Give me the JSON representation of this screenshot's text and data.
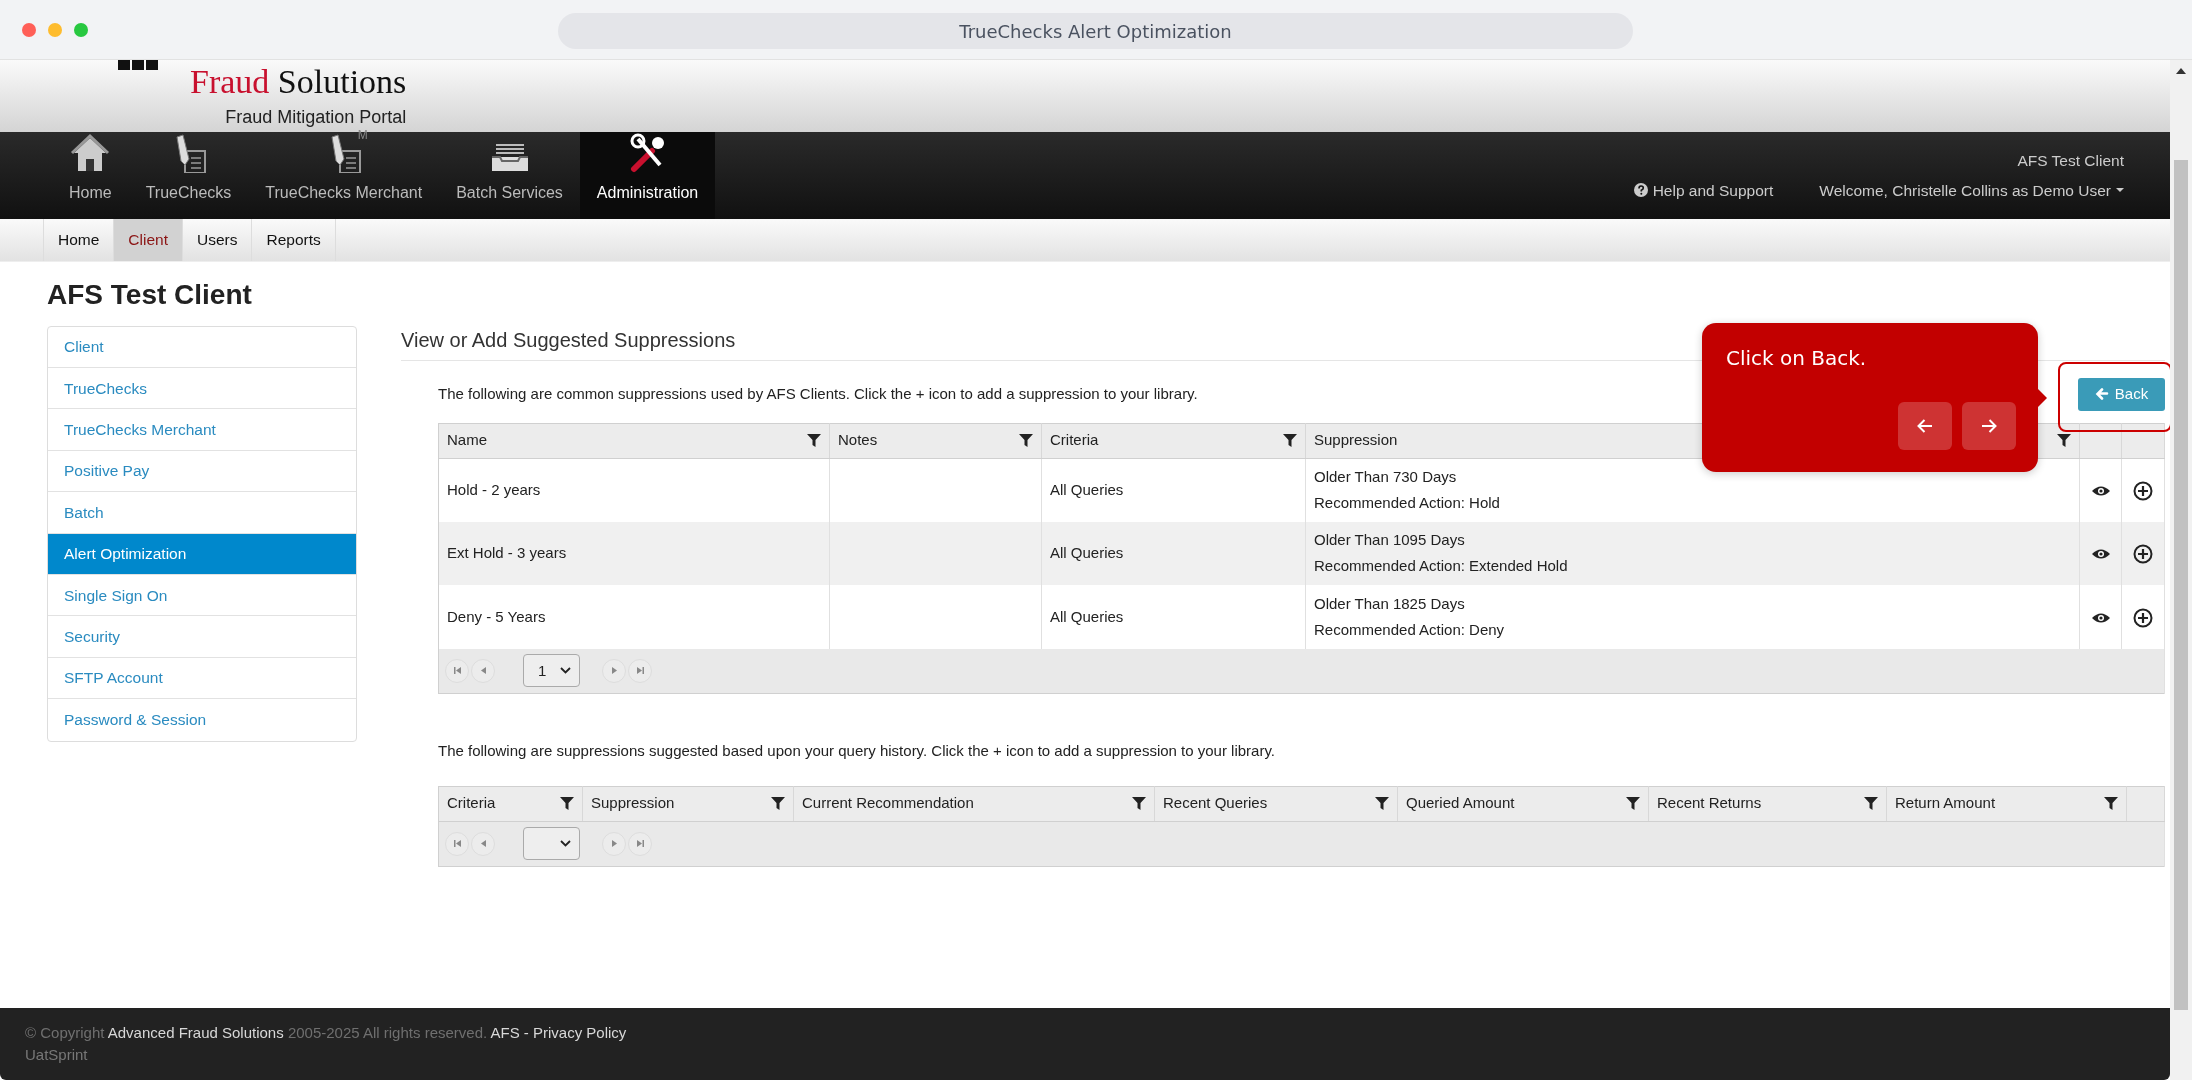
{
  "window": {
    "title": "TrueChecks Alert Optimization"
  },
  "header": {
    "logo_words": [
      {
        "text": "Fraud",
        "accent": true
      },
      {
        "text": "Solutions",
        "accent": false
      }
    ],
    "logo_subtitle": "Fraud Mitigation Portal"
  },
  "nav": {
    "items": [
      {
        "kind": "home",
        "label": "Home",
        "selected": false
      },
      {
        "kind": "pen",
        "label": "TrueChecks",
        "selected": false
      },
      {
        "kind": "pen",
        "label": "TrueChecks Merchant",
        "icon_letter": "M",
        "selected": false
      },
      {
        "kind": "tray",
        "label": "Batch Services",
        "selected": false
      },
      {
        "kind": "tools",
        "label": "Administration",
        "selected": true
      }
    ],
    "client": "AFS Test Client",
    "help": "Help and Support",
    "user": "Welcome, Christelle Collins as Demo User"
  },
  "subnav": [
    {
      "label": "Home",
      "selected": false
    },
    {
      "label": "Client",
      "selected": true
    },
    {
      "label": "Users",
      "selected": false
    },
    {
      "label": "Reports",
      "selected": false
    }
  ],
  "page_title": "AFS Test Client",
  "sidebar": {
    "items": [
      {
        "label": "Client",
        "selected": false
      },
      {
        "label": "TrueChecks",
        "selected": false
      },
      {
        "label": "TrueChecks Merchant",
        "selected": false
      },
      {
        "label": "Positive Pay",
        "selected": false
      },
      {
        "label": "Batch",
        "selected": false
      },
      {
        "label": "Alert Optimization",
        "selected": true
      },
      {
        "label": "Single Sign On",
        "selected": false
      },
      {
        "label": "Security",
        "selected": false
      },
      {
        "label": "SFTP Account",
        "selected": false
      },
      {
        "label": "Password & Session",
        "selected": false
      }
    ]
  },
  "section": {
    "title": "View or Add Suggested Suppressions",
    "intro": "The following are common suppressions used by AFS Clients. Click the + icon to add a suppression to your library.",
    "back_button": "Back",
    "table": {
      "columns": [
        {
          "label": "Name",
          "filter": true
        },
        {
          "label": "Notes",
          "filter": true
        },
        {
          "label": "Criteria",
          "filter": true
        },
        {
          "label": "Suppression",
          "filter": true
        }
      ],
      "rows": [
        {
          "name": "Hold - 2 years",
          "criteria": "All Queries",
          "suppression": [
            "Older Than 730 Days",
            "Recommended Action: Hold"
          ]
        },
        {
          "name": "Ext Hold - 3 years",
          "criteria": "All Queries",
          "suppression": [
            "Older Than 1095 Days",
            "Recommended Action: Extended Hold"
          ]
        },
        {
          "name": "Deny - 5 Years",
          "criteria": "All Queries",
          "suppression": [
            "Older Than 1825 Days",
            "Recommended Action: Deny"
          ]
        }
      ],
      "pager": {
        "page": "1"
      }
    },
    "history_intro": "The following are suppressions suggested based upon your query history. Click the + icon to add a suppression to your library.",
    "history_table": {
      "columns": [
        {
          "label": "Criteria",
          "filter": true
        },
        {
          "label": "Suppression",
          "filter": true
        },
        {
          "label": "Current Recommendation",
          "filter": true
        },
        {
          "label": "Recent Queries",
          "filter": true
        },
        {
          "label": "Queried Amount",
          "filter": true
        },
        {
          "label": "Recent Returns",
          "filter": true
        },
        {
          "label": "Return Amount",
          "filter": true
        }
      ]
    }
  },
  "tooltip": {
    "text": "Click on Back."
  },
  "footer": {
    "line": [
      {
        "text": "© Copyright ",
        "link": false
      },
      {
        "text": "Advanced Fraud Solutions",
        "link": true
      },
      {
        "text": " 2005-2025 All rights reserved. ",
        "link": false
      },
      {
        "text": "AFS - Privacy Policy",
        "link": true
      }
    ],
    "env": "UatSprint"
  }
}
